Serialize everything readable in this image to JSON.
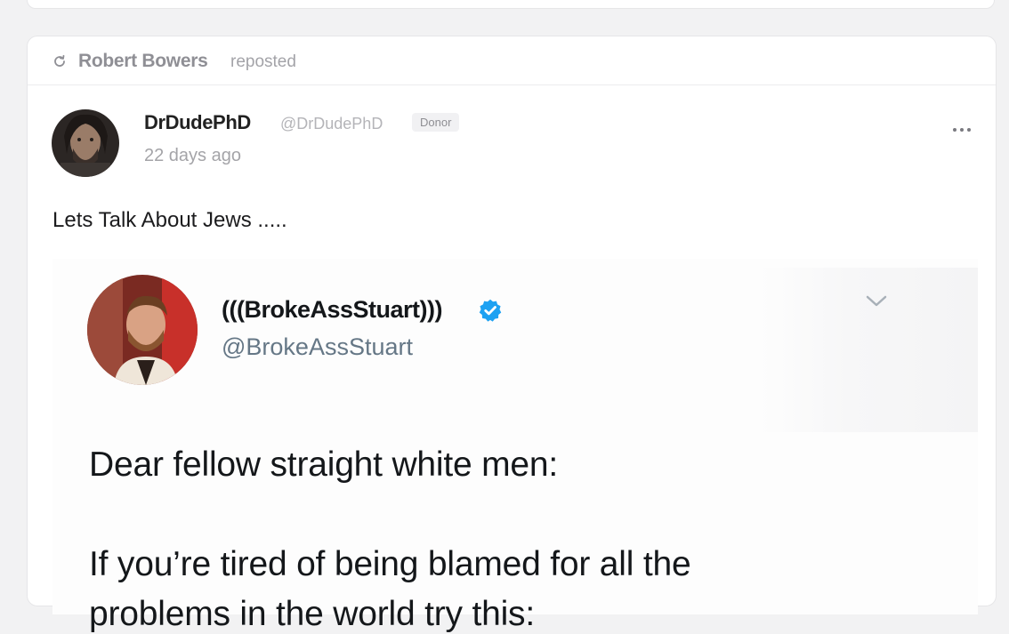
{
  "repost": {
    "user_name": "Robert Bowers",
    "verb": "reposted"
  },
  "post": {
    "author_name": "DrDudePhD",
    "author_handle": "@DrDudePhD",
    "badge": "Donor",
    "time": "22 days ago",
    "more_icon": "more-horizontal-icon",
    "text": "Lets Talk About Jews ....."
  },
  "embedded_tweet": {
    "display_name": "(((BrokeAssStuart)))",
    "handle": "@BrokeAssStuart",
    "verified_icon": "verified-badge-icon",
    "verified_color": "#1da1f2",
    "chevron_icon": "chevron-down-icon",
    "line1": "Dear fellow straight white men:",
    "line2": "If you’re tired of being blamed for all the",
    "line3": "problems in the world try this:"
  }
}
